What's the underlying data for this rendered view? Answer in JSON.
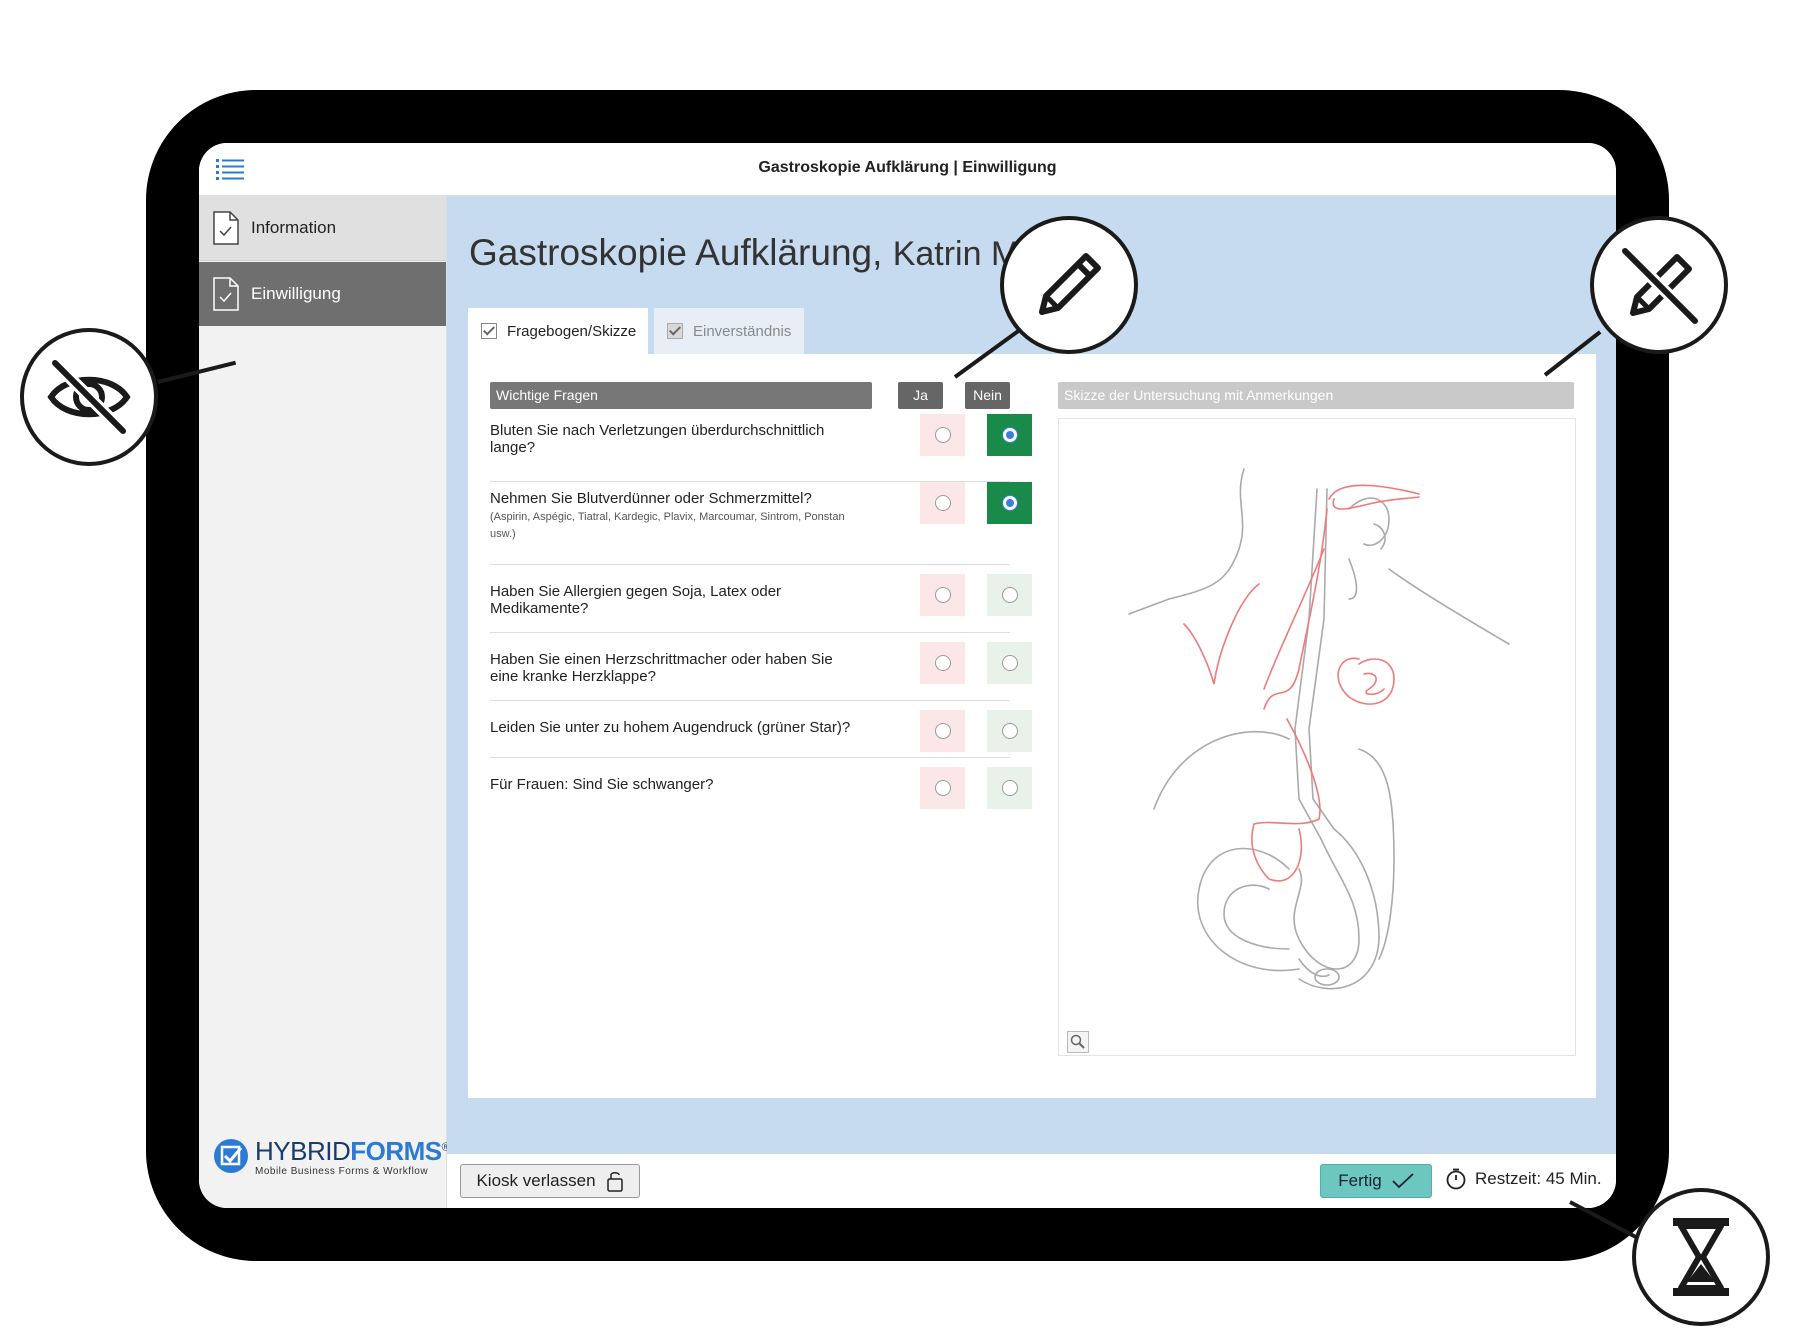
{
  "app": {
    "title": "Gastroskopie Aufklärung | Einwilligung"
  },
  "sidebar": {
    "items": [
      {
        "label": "Information"
      },
      {
        "label": "Einwilligung"
      }
    ],
    "logo": {
      "brand_light": "HYBRID",
      "brand_bold": "FORMS",
      "registered": "®",
      "tagline": "Mobile Business Forms & Workflow"
    }
  },
  "main": {
    "title": "Gastroskopie Aufklärung,",
    "patient_name": "Katrin M",
    "tabs": [
      {
        "label": "Fragebogen/Skizze"
      },
      {
        "label": "Einverständnis"
      }
    ],
    "questions_header": "Wichtige Fragen",
    "col_yes": "Ja",
    "col_no": "Nein",
    "sketch_header": "Skizze der Untersuchung mit Anmerkungen",
    "questions": [
      {
        "text": "Bluten Sie nach Verletzungen überdurchschnittlich lange?",
        "sub": "",
        "answer": "Nein"
      },
      {
        "text": "Nehmen Sie Blutverdünner oder Schmerzmittel?",
        "sub": "(Aspirin, Aspégic, Tiatral, Kardegic, Plavix, Marcoumar, Sintrom, Ponstan usw.)",
        "answer": "Nein"
      },
      {
        "text": "Haben Sie Allergien gegen Soja, Latex oder Medikamente?",
        "sub": "",
        "answer": ""
      },
      {
        "text": "Haben Sie einen Herzschrittmacher oder haben Sie eine kranke Herzklappe?",
        "sub": "",
        "answer": ""
      },
      {
        "text": "Leiden Sie unter zu hohem Augendruck (grüner Star)?",
        "sub": "",
        "answer": ""
      },
      {
        "text": "Für Frauen: Sind Sie schwanger?",
        "sub": "",
        "answer": ""
      }
    ]
  },
  "footer": {
    "kiosk_label": "Kiosk verlassen",
    "done_label": "Fertig",
    "timer_label": "Restzeit: 45 Min."
  },
  "colors": {
    "accent": "#1a8a4a",
    "done": "#6cc7c0",
    "content_bg": "#c6dbef",
    "sidebar_active": "#6f6f6f"
  },
  "callouts": [
    "eye-slash-icon",
    "pencil-icon",
    "pencil-slash-icon",
    "hourglass-icon"
  ]
}
